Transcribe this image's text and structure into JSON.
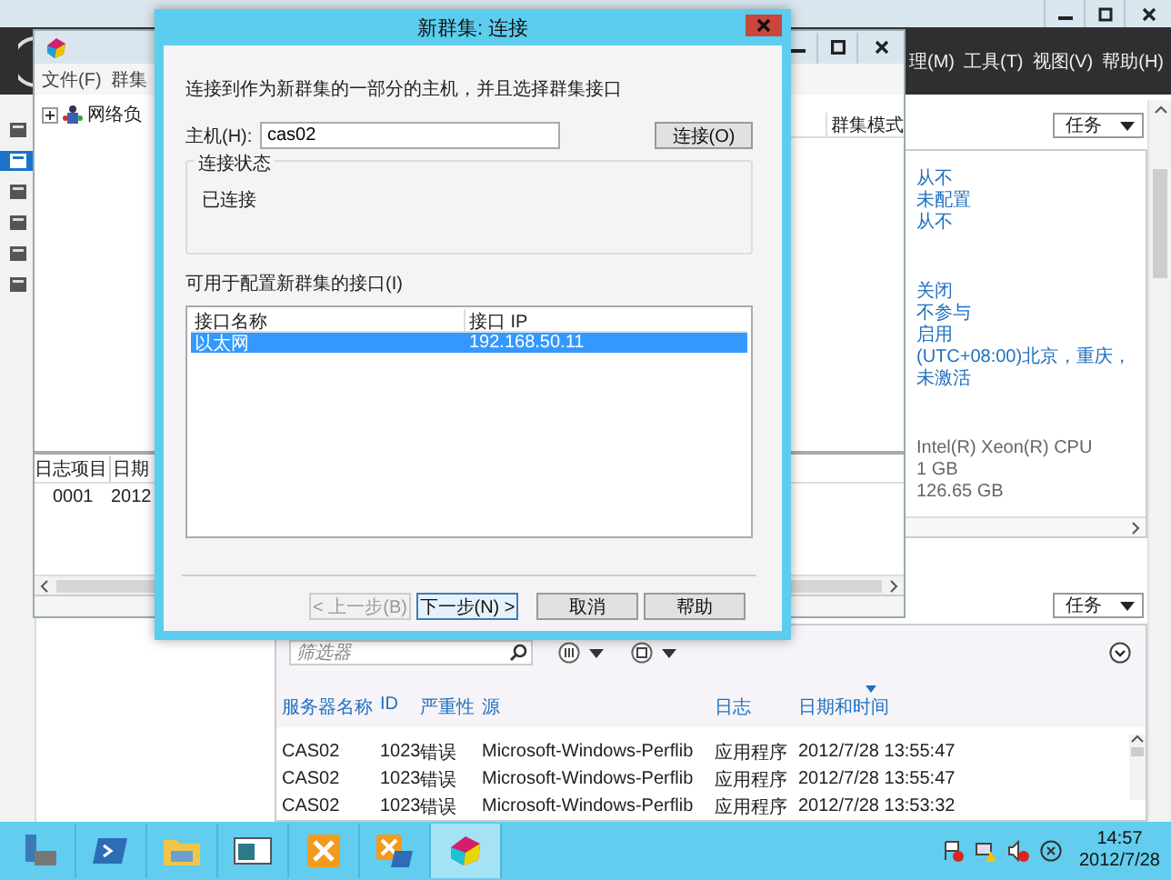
{
  "server_manager": {
    "nav_items": [
      {
        "selected": false
      },
      {
        "selected": true
      },
      {
        "selected": false
      },
      {
        "selected": false
      },
      {
        "selected": false
      },
      {
        "selected": false
      }
    ],
    "menu": [
      "理(M)",
      "工具(T)",
      "视图(V)",
      "帮助(H)"
    ],
    "tasks_buttons": [
      "任务",
      "任务"
    ],
    "property_groups": [
      [
        {
          "text": "从不",
          "kind": "link"
        },
        {
          "text": "未配置",
          "kind": "link"
        },
        {
          "text": "从不",
          "kind": "link"
        }
      ],
      [
        {
          "text": "关闭",
          "kind": "link"
        },
        {
          "text": "不参与",
          "kind": "link"
        },
        {
          "text": "启用",
          "kind": "link"
        },
        {
          "text": "(UTC+08:00)北京，重庆，",
          "kind": "link"
        },
        {
          "text": "未激活",
          "kind": "link"
        }
      ],
      [
        {
          "text": "Intel(R) Xeon(R) CPU",
          "kind": "plain"
        },
        {
          "text": "1 GB",
          "kind": "plain"
        },
        {
          "text": "126.65 GB",
          "kind": "plain"
        }
      ]
    ],
    "events": {
      "filter": {
        "placeholder": "筛选器"
      },
      "columns": [
        {
          "label": "服务器名称",
          "sorted": false
        },
        {
          "label": "ID",
          "sorted": false
        },
        {
          "label": "严重性",
          "sorted": false
        },
        {
          "label": "源",
          "sorted": false
        },
        {
          "label": "日志",
          "sorted": false
        },
        {
          "label": "日期和时间",
          "sorted": true
        }
      ],
      "rows": [
        [
          "CAS02",
          "1023",
          "错误",
          "Microsoft-Windows-Perflib",
          "应用程序",
          "2012/7/28 13:55:47"
        ],
        [
          "CAS02",
          "1023",
          "错误",
          "Microsoft-Windows-Perflib",
          "应用程序",
          "2012/7/28 13:55:47"
        ],
        [
          "CAS02",
          "1023",
          "错误",
          "Microsoft-Windows-Perflib",
          "应用程序",
          "2012/7/28 13:53:32"
        ]
      ]
    }
  },
  "nlb_window": {
    "menu": [
      "文件(F)",
      "群集"
    ],
    "tree": [
      {
        "label": "网络负",
        "expanded": false
      }
    ],
    "list_column": "群集模式",
    "log_columns": [
      "日志项目",
      "日期"
    ],
    "log_rows": [
      [
        "0001",
        "2012"
      ]
    ]
  },
  "dialog": {
    "title": "新群集: 连接",
    "instruction": "连接到作为新群集的一部分的主机，并且选择群集接口",
    "host": {
      "label": "主机(H):",
      "value": "cas02"
    },
    "connect_button": "连接(O)",
    "status": {
      "legend": "连接状态",
      "text": "已连接"
    },
    "interfaces": {
      "label": "可用于配置新群集的接口(I)",
      "columns": [
        "接口名称",
        "接口 IP"
      ],
      "rows": [
        {
          "cells": [
            "以太网",
            "192.168.50.11"
          ],
          "selected": true
        }
      ]
    },
    "buttons": [
      {
        "label": "< 上一步(B)",
        "disabled": true,
        "focused": false
      },
      {
        "label": "下一步(N) >",
        "disabled": false,
        "focused": true
      },
      {
        "label": "取消",
        "disabled": false,
        "focused": false
      },
      {
        "label": "帮助",
        "disabled": false,
        "focused": false
      }
    ]
  },
  "taskbar": {
    "apps": [
      {
        "kind": "server",
        "selected": false
      },
      {
        "kind": "shell",
        "selected": false
      },
      {
        "kind": "folder",
        "selected": false
      },
      {
        "kind": "window",
        "selected": false
      },
      {
        "kind": "exchange",
        "selected": false
      },
      {
        "kind": "exchange-shell",
        "selected": false
      },
      {
        "kind": "nlb",
        "selected": true
      }
    ],
    "clock": {
      "time": "14:57",
      "date": "2012/7/28"
    }
  }
}
